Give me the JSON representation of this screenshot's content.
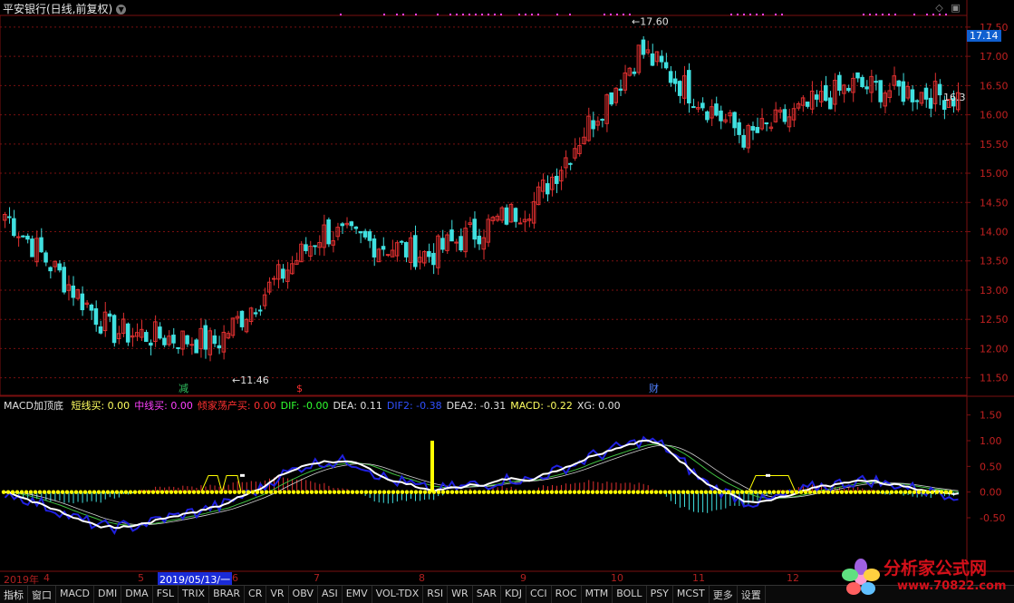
{
  "window": {
    "title": "平安银行(日线,前复权)",
    "dropdown_icon": "chevron-down-icon",
    "restore_icon": "restore-icon",
    "close_icon": "close-icon"
  },
  "colors": {
    "up": "#e03030",
    "down": "#40e0e0",
    "grid": "#7a1010",
    "background": "#000000",
    "white_line": "#ffffff",
    "blue_line": "#2020e0",
    "yellow": "#ffff00"
  },
  "main_chart": {
    "price_axis_ticks": [
      "17.50",
      "17.00",
      "16.50",
      "16.00",
      "15.50",
      "15.00",
      "14.50",
      "14.00",
      "13.50",
      "13.00",
      "12.50",
      "12.00",
      "11.50"
    ],
    "current_price_label": "17.14",
    "right_price_label": "16.3",
    "high_label": "17.60",
    "low_label": "11.46",
    "event_markers": [
      "减",
      "$",
      "财"
    ]
  },
  "indicator": {
    "name": "MACD加顶底",
    "fields": [
      {
        "label": "短线买: 0.00",
        "color": "#ffff60"
      },
      {
        "label": "中线买: 0.00",
        "color": "#ff40ff"
      },
      {
        "label": "倾家荡产买: 0.00",
        "color": "#ff3030"
      },
      {
        "label": "DIF: -0.00",
        "color": "#30ff30"
      },
      {
        "label": "DEA: 0.11",
        "color": "#e0e0e0"
      },
      {
        "label": "DIF2: -0.38",
        "color": "#3050ff"
      },
      {
        "label": "DEA2: -0.31",
        "color": "#e0e0e0"
      },
      {
        "label": "MACD: -0.22",
        "color": "#ffff60"
      },
      {
        "label": "XG: 0.00",
        "color": "#e0e0e0"
      }
    ],
    "axis_ticks": [
      "1.50",
      "1.00",
      "0.50",
      "0.00",
      "-0.50"
    ]
  },
  "x_axis": {
    "year_label": "2019年",
    "months": [
      "4",
      "5",
      "6",
      "7",
      "8",
      "9",
      "10",
      "11",
      "12"
    ],
    "cursor_date": "2019/05/13/一"
  },
  "tabs": [
    "指标",
    "窗口",
    "MACD",
    "DMI",
    "DMA",
    "FSL",
    "TRIX",
    "BRAR",
    "CR",
    "VR",
    "OBV",
    "ASI",
    "EMV",
    "VOL-TDX",
    "RSI",
    "WR",
    "SAR",
    "KDJ",
    "CCI",
    "ROC",
    "MTM",
    "BOLL",
    "PSY",
    "MCST",
    "更多",
    "设置"
  ],
  "watermark": {
    "text": "分析家公式网",
    "url": "www.70822.com"
  },
  "chart_data": {
    "type": "candlestick",
    "title": "平安银行(日线,前复权)",
    "ylim": [
      11.2,
      17.7
    ],
    "high": 17.6,
    "low": 11.46,
    "last": 16.3,
    "monthly_closes": {
      "x": [
        "4",
        "5",
        "6",
        "7",
        "8",
        "9",
        "10",
        "11",
        "12"
      ],
      "values": [
        14.3,
        12.3,
        12.3,
        14.0,
        13.6,
        14.5,
        16.3,
        15.6,
        16.9
      ]
    },
    "indicator_series": {
      "ylim": [
        -0.8,
        1.6
      ],
      "DIF": -0.0,
      "DEA": 0.11,
      "DIF2": -0.38,
      "DEA2": -0.31,
      "MACD": -0.22,
      "XG": 0.0
    }
  }
}
